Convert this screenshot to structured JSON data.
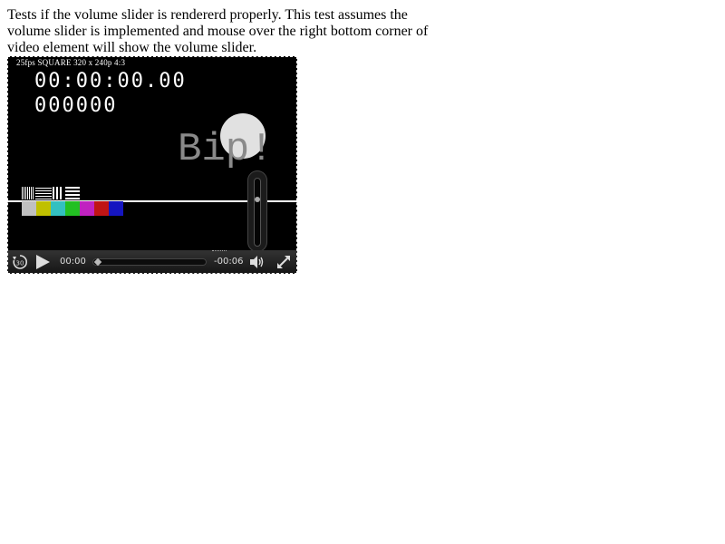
{
  "description": "Tests if the volume slider is rendererd properly. This test assumes the volume slider is implemented and mouse over the right bottom corner of video element will show the volume slider.",
  "video": {
    "caption": "25fps SQUARE 320 x 240p 4:3",
    "timecode": "00:00:00.00",
    "frame_counter": "000000",
    "overlay_text": "Bip!",
    "color_bars": [
      "#c0c0c0",
      "#c0c000",
      "#33c0c0",
      "#22c022",
      "#c022c0",
      "#c01515",
      "#1515c0"
    ]
  },
  "controls": {
    "current_time": "00:00",
    "remaining_time": "-00:06",
    "rewind_icon": "rewind-30-icon",
    "play_icon": "play-icon",
    "volume_icon": "speaker-icon",
    "fullscreen_icon": "fullscreen-icon",
    "progress": 0,
    "volume_level": 0.7
  }
}
